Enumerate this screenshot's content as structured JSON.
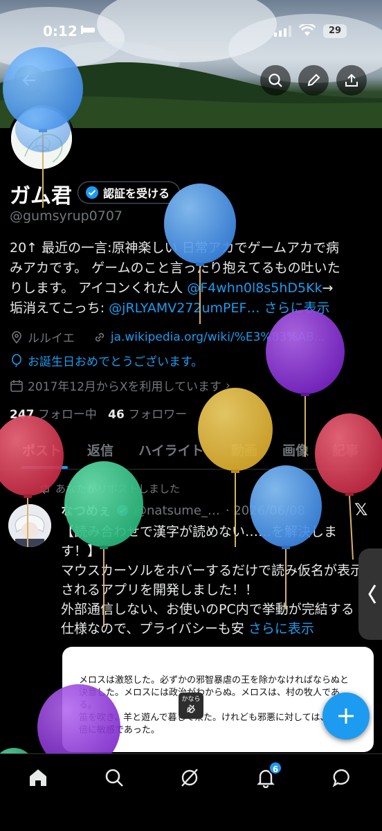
{
  "status": {
    "time": "0:12",
    "battery": "29"
  },
  "profile": {
    "display_name": "ガム君",
    "verify_label": "認証を受ける",
    "handle": "@gumsyrup0707",
    "bio_line1": "20↑ 最近の一言:原神楽しい 日常アカでゲームアカで病",
    "bio_line2": "みアカです。 ゲームのこと言ったり抱えてるもの吐いた",
    "bio_line3_a": "りします。 アイコンくれた人 ",
    "bio_line3_link": "@F4whn0l8s5hD5Kk",
    "bio_line3_b": "→",
    "bio_line4_a": "垢消えてこっち: ",
    "bio_line4_link": "@jRLYAMV272umPEF…",
    "bio_more": "さらに表示",
    "location": "ルルイエ",
    "website": "ja.wikipedia.org/wiki/%E3%83%AB...",
    "birthday": "お誕生日おめでとうございます。",
    "joined": "2017年12月からXを利用しています",
    "following_count": "247",
    "following_label": "フォロー中",
    "followers_count": "46",
    "followers_label": "フォロワー"
  },
  "tabs": [
    "ポスト",
    "返信",
    "ハイライト",
    "動画",
    "画像",
    "記事"
  ],
  "post": {
    "repost_note": "あなたがリポストしました",
    "author": "なつめぇ",
    "handle": "@natsume_…",
    "date": "· 2026/06/08",
    "body": "【読み合わせで漢字が読めない……を解決します！】\nマウスカーソルをホバーするだけで読み仮名が表示されるアプリを開発しました！！\n外部通信しない、お使いのPC内で挙動が完結する仕様なので、プライバシーも安 ",
    "more": "さらに表示",
    "card_text": "メロスは激怒した。必ずかの邪智暴虐の王を除かなければならぬと決意した。メロスには政治がわからぬ。メロスは、村の牧人である。\n笛を吹き、羊と遊んで暮して来た。けれども邪悪に対しては、人一倍に敏感であった。",
    "badge_top": "かなら",
    "badge_kanji": "必"
  },
  "nav": {
    "notification_count": "6"
  },
  "colors": {
    "accent": "#1d9bf0",
    "background": "#000000",
    "muted": "#71767b"
  }
}
